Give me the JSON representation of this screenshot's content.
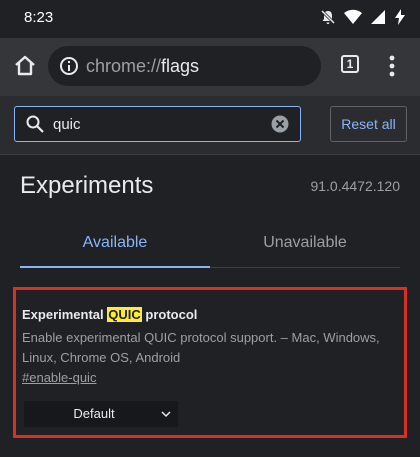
{
  "status_bar": {
    "time": "8:23",
    "icons": [
      "bell-muted-icon",
      "wifi-icon",
      "signal-icon",
      "battery-charging-icon"
    ]
  },
  "toolbar": {
    "url_scheme": "chrome://",
    "url_host": "flags",
    "tab_count": "1",
    "icons": [
      "home-icon",
      "info-icon",
      "overflow-menu-icon"
    ]
  },
  "search": {
    "value": "quic",
    "reset_label": "Reset all"
  },
  "header": {
    "title": "Experiments",
    "version": "91.0.4472.120"
  },
  "tabs": [
    {
      "label": "Available",
      "selected": true
    },
    {
      "label": "Unavailable",
      "selected": false
    }
  ],
  "flag": {
    "title_before": "Experimental ",
    "title_highlight": "QUIC",
    "title_after": " protocol",
    "description": "Enable experimental QUIC protocol support. – Mac, Windows, Linux, Chrome OS, Android",
    "link": "#enable-quic",
    "selected_option": "Default"
  },
  "colors": {
    "background": "#202124",
    "toolbar": "#35363a",
    "accent": "#8ab4f8",
    "highlight": "#ffeb3b",
    "card_border": "#d93025"
  }
}
